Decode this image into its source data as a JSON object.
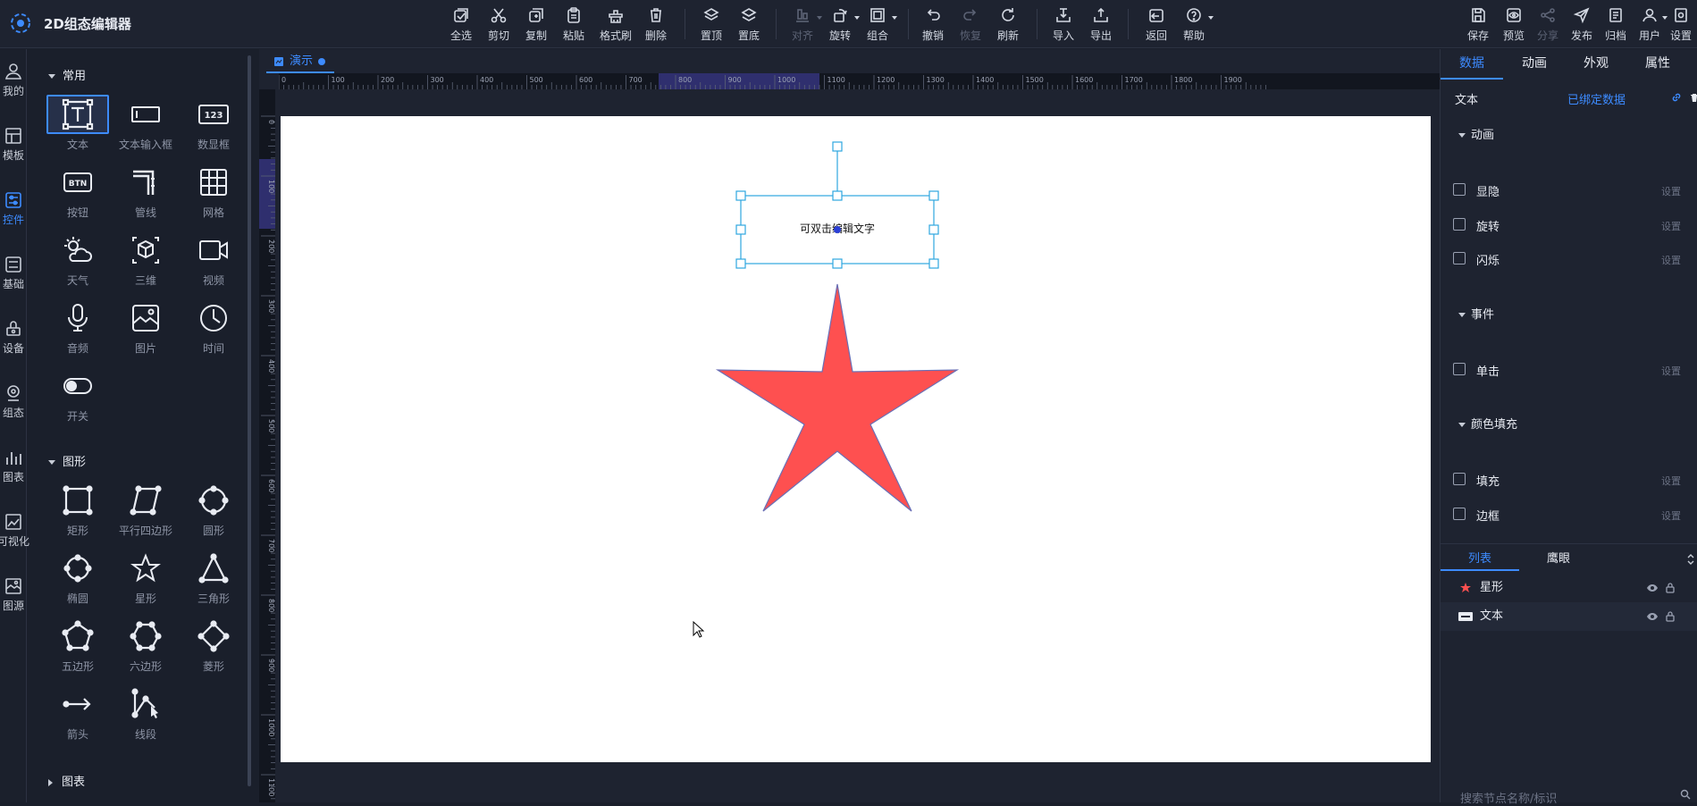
{
  "app": {
    "title": "2D组态编辑器"
  },
  "toolbar": {
    "select_all": "全选",
    "cut": "剪切",
    "copy": "复制",
    "paste": "粘贴",
    "format_brush": "格式刷",
    "delete": "删除",
    "bring_front": "置顶",
    "send_back": "置底",
    "align": "对齐",
    "rotate": "旋转",
    "group": "组合",
    "undo": "撤销",
    "redo": "恢复",
    "refresh": "刷新",
    "import": "导入",
    "export": "导出",
    "back": "返回",
    "help": "帮助",
    "save": "保存",
    "preview": "预览",
    "share": "分享",
    "publish": "发布",
    "archive": "归档",
    "user": "用户",
    "settings": "设置"
  },
  "leftnav": {
    "mine": "我的",
    "template": "模板",
    "control": "控件",
    "basic": "基础",
    "device": "设备",
    "config": "组态",
    "chart": "图表",
    "visual": "可视化",
    "source": "图源"
  },
  "palette": {
    "common_title": "常用",
    "common": [
      "文本",
      "文本输入框",
      "数显框",
      "按钮",
      "管线",
      "网格",
      "天气",
      "三维",
      "视频",
      "音频",
      "图片",
      "时间",
      "开关"
    ],
    "number_box_text": "123",
    "button_text": "BTN",
    "shapes_title": "图形",
    "shapes": [
      "矩形",
      "平行四边形",
      "圆形",
      "椭圆",
      "星形",
      "三角形",
      "五边形",
      "六边形",
      "菱形",
      "箭头",
      "线段"
    ],
    "charts_title": "图表"
  },
  "canvas": {
    "doc_tab": "演示",
    "text_element": "可双击编辑文字",
    "hruler_ticks": [
      "0",
      "100",
      "200",
      "300",
      "400",
      "500",
      "600",
      "700",
      "800",
      "900",
      "1000",
      "1100",
      "1200",
      "1300",
      "1400",
      "1500",
      "1600",
      "1700",
      "1800",
      "1900"
    ],
    "vruler_ticks": [
      "0",
      "100",
      "200",
      "300",
      "400",
      "500",
      "600",
      "700",
      "800",
      "900",
      "1000",
      "1100"
    ],
    "star_fill": "#fe5050",
    "selection_color": "#2ea7e0"
  },
  "rightpanel": {
    "tabs": [
      "数据",
      "动画",
      "外观",
      "属性"
    ],
    "text_label": "文本",
    "bound_data": "已绑定数据",
    "anim_section": "动画",
    "anim_items": [
      "显隐",
      "旋转",
      "闪烁"
    ],
    "event_section": "事件",
    "event_items": [
      "单击"
    ],
    "color_section": "颜色填充",
    "color_items": [
      "填充",
      "边框"
    ],
    "set_label": "设置",
    "list_tabs": [
      "列表",
      "鹰眼"
    ],
    "layers": [
      "星形",
      "文本"
    ],
    "search_placeholder": "搜索节点名称/标识"
  },
  "colors": {
    "accent": "#3d8bff",
    "bg": "#1a1f2b"
  }
}
